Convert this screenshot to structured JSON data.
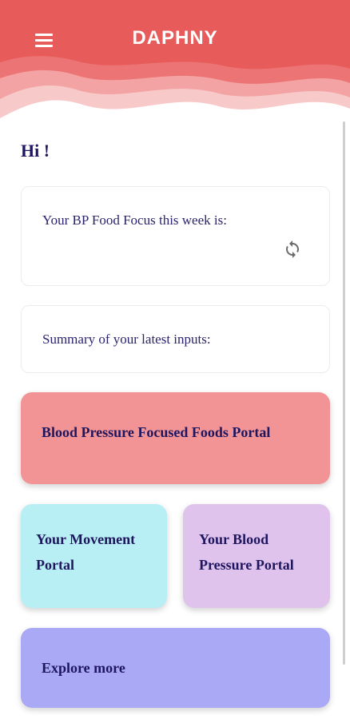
{
  "header": {
    "title": "DAPHNY",
    "menu_icon": "hamburger-menu-icon",
    "colors": {
      "primary": "#e85b5b",
      "wave_light": "#f6b8b8"
    }
  },
  "greeting": "Hi !",
  "focus_card": {
    "label": "Your BP Food Focus this week is:",
    "refresh_icon": "refresh-icon"
  },
  "summary_card": {
    "label": "Summary of your latest inputs:"
  },
  "portals": {
    "foods": {
      "label": "Blood Pressure Focused Foods Portal",
      "color": "#f29495"
    },
    "movement": {
      "label": "Your Movement Portal",
      "color": "#b8eff4"
    },
    "blood_pressure": {
      "label": "Your Blood Pressure Portal",
      "color": "#dfc3ec"
    },
    "explore": {
      "label": "Explore more",
      "color": "#a9a9f5"
    }
  }
}
